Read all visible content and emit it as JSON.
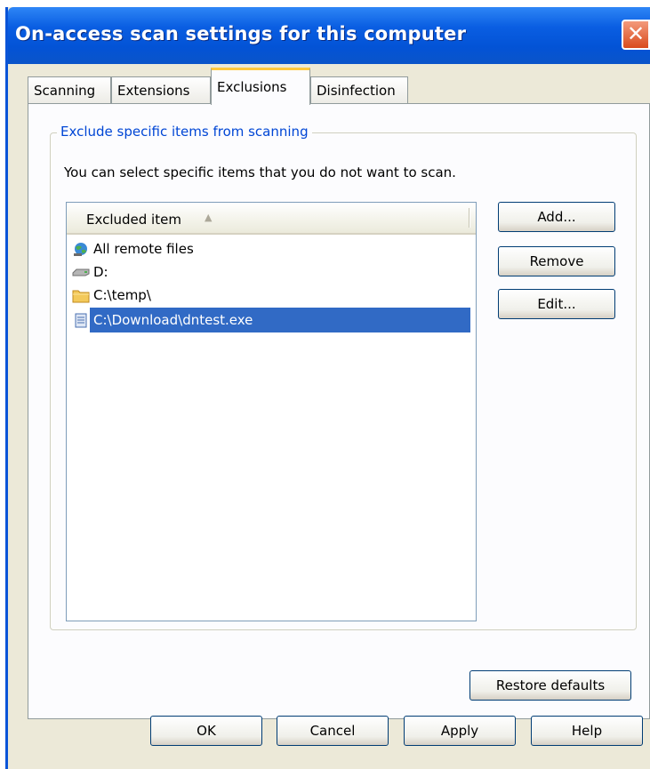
{
  "window": {
    "title": "On-access scan settings for this computer",
    "close_glyph": "✕"
  },
  "tabs": [
    {
      "label": "Scanning"
    },
    {
      "label": "Extensions"
    },
    {
      "label": "Exclusions",
      "active": true
    },
    {
      "label": "Disinfection"
    }
  ],
  "group": {
    "title": "Exclude specific items from scanning",
    "description": "You can select specific items that you do not want to scan."
  },
  "list": {
    "column_header": "Excluded item",
    "sort_glyph": "▲",
    "items": [
      {
        "label": "All remote files",
        "icon": "globe-network-icon"
      },
      {
        "label": "D:",
        "icon": "drive-icon"
      },
      {
        "label": "C:\\temp\\",
        "icon": "folder-icon"
      },
      {
        "label": "C:\\Download\\dntest.exe",
        "icon": "file-icon",
        "selected": true
      }
    ]
  },
  "buttons": {
    "add": "Add...",
    "remove": "Remove",
    "edit": "Edit...",
    "restore_defaults": "Restore defaults",
    "ok": "OK",
    "cancel": "Cancel",
    "apply": "Apply",
    "help": "Help"
  },
  "colors": {
    "selection": "#316ac5",
    "group_title": "#0046d5",
    "active_tab_accent": "#ffc83c"
  }
}
